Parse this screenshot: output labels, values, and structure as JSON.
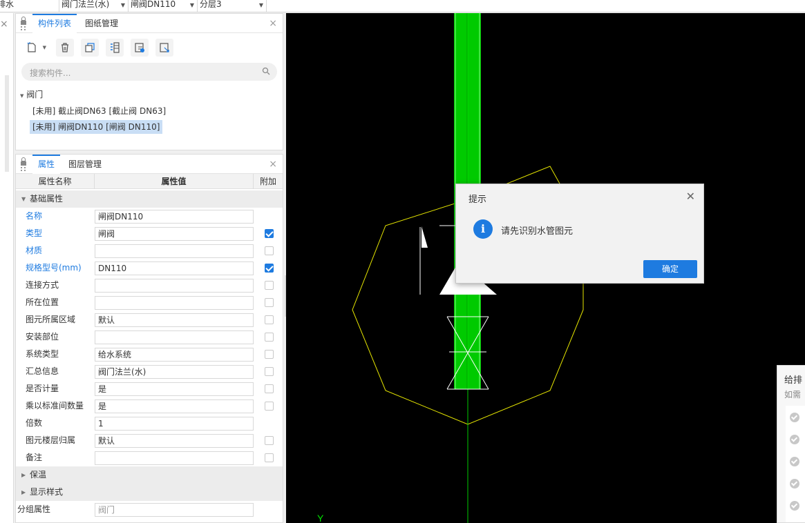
{
  "top_toolbar": {
    "combos": [
      {
        "value": "排水"
      },
      {
        "value": "阀门法兰(水)"
      },
      {
        "value": "闸阀DN110"
      },
      {
        "value": "分层3"
      }
    ]
  },
  "component_panel": {
    "tabs": [
      "构件列表",
      "图纸管理"
    ],
    "active_tab": "构件列表",
    "search_placeholder": "搜索构件...",
    "tree": {
      "root": "阀门",
      "items": [
        {
          "label": "[未用] 截止阀DN63 [截止阀 DN63]",
          "selected": false
        },
        {
          "label": "[未用] 闸阀DN110 [闸阀 DN110]",
          "selected": true
        }
      ]
    }
  },
  "property_panel": {
    "tabs": [
      "属性",
      "图层管理"
    ],
    "active_tab": "属性",
    "columns": [
      "属性名称",
      "属性值",
      "附加"
    ],
    "group_basic": "基础属性",
    "rows": [
      {
        "name": "名称",
        "value": "闸阀DN110",
        "blue": true,
        "check": null
      },
      {
        "name": "类型",
        "value": "闸阀",
        "blue": true,
        "check": true
      },
      {
        "name": "材质",
        "value": "",
        "blue": true,
        "check": false
      },
      {
        "name": "规格型号(mm)",
        "value": "DN110",
        "blue": true,
        "check": true
      },
      {
        "name": "连接方式",
        "value": "",
        "blue": false,
        "check": false
      },
      {
        "name": "所在位置",
        "value": "",
        "blue": false,
        "check": false
      },
      {
        "name": "图元所属区域",
        "value": "默认",
        "blue": false,
        "check": false
      },
      {
        "name": "安装部位",
        "value": "",
        "blue": false,
        "check": false
      },
      {
        "name": "系统类型",
        "value": "给水系统",
        "blue": false,
        "check": false
      },
      {
        "name": "汇总信息",
        "value": "阀门法兰(水)",
        "blue": false,
        "check": false
      },
      {
        "name": "是否计量",
        "value": "是",
        "blue": false,
        "check": false
      },
      {
        "name": "乘以标准间数量",
        "value": "是",
        "blue": false,
        "check": false
      },
      {
        "name": "倍数",
        "value": "1",
        "blue": false,
        "check": null
      },
      {
        "name": "图元楼层归属",
        "value": "默认",
        "blue": false,
        "check": false
      },
      {
        "name": "备注",
        "value": "",
        "blue": false,
        "check": false
      }
    ],
    "group_insulation": "保温",
    "group_display": "显示样式",
    "group_attr_name": "分组属性",
    "group_attr_value": "阀门"
  },
  "canvas": {
    "axis_label": "Y",
    "pipe_color": "#00e000",
    "octagon_color": "#e6e600"
  },
  "dialog": {
    "title": "提示",
    "message": "请先识别水管图元",
    "ok_label": "确定",
    "accent": "#1e7be0"
  },
  "right_panel": {
    "title": "给排",
    "subtitle": "如需"
  }
}
